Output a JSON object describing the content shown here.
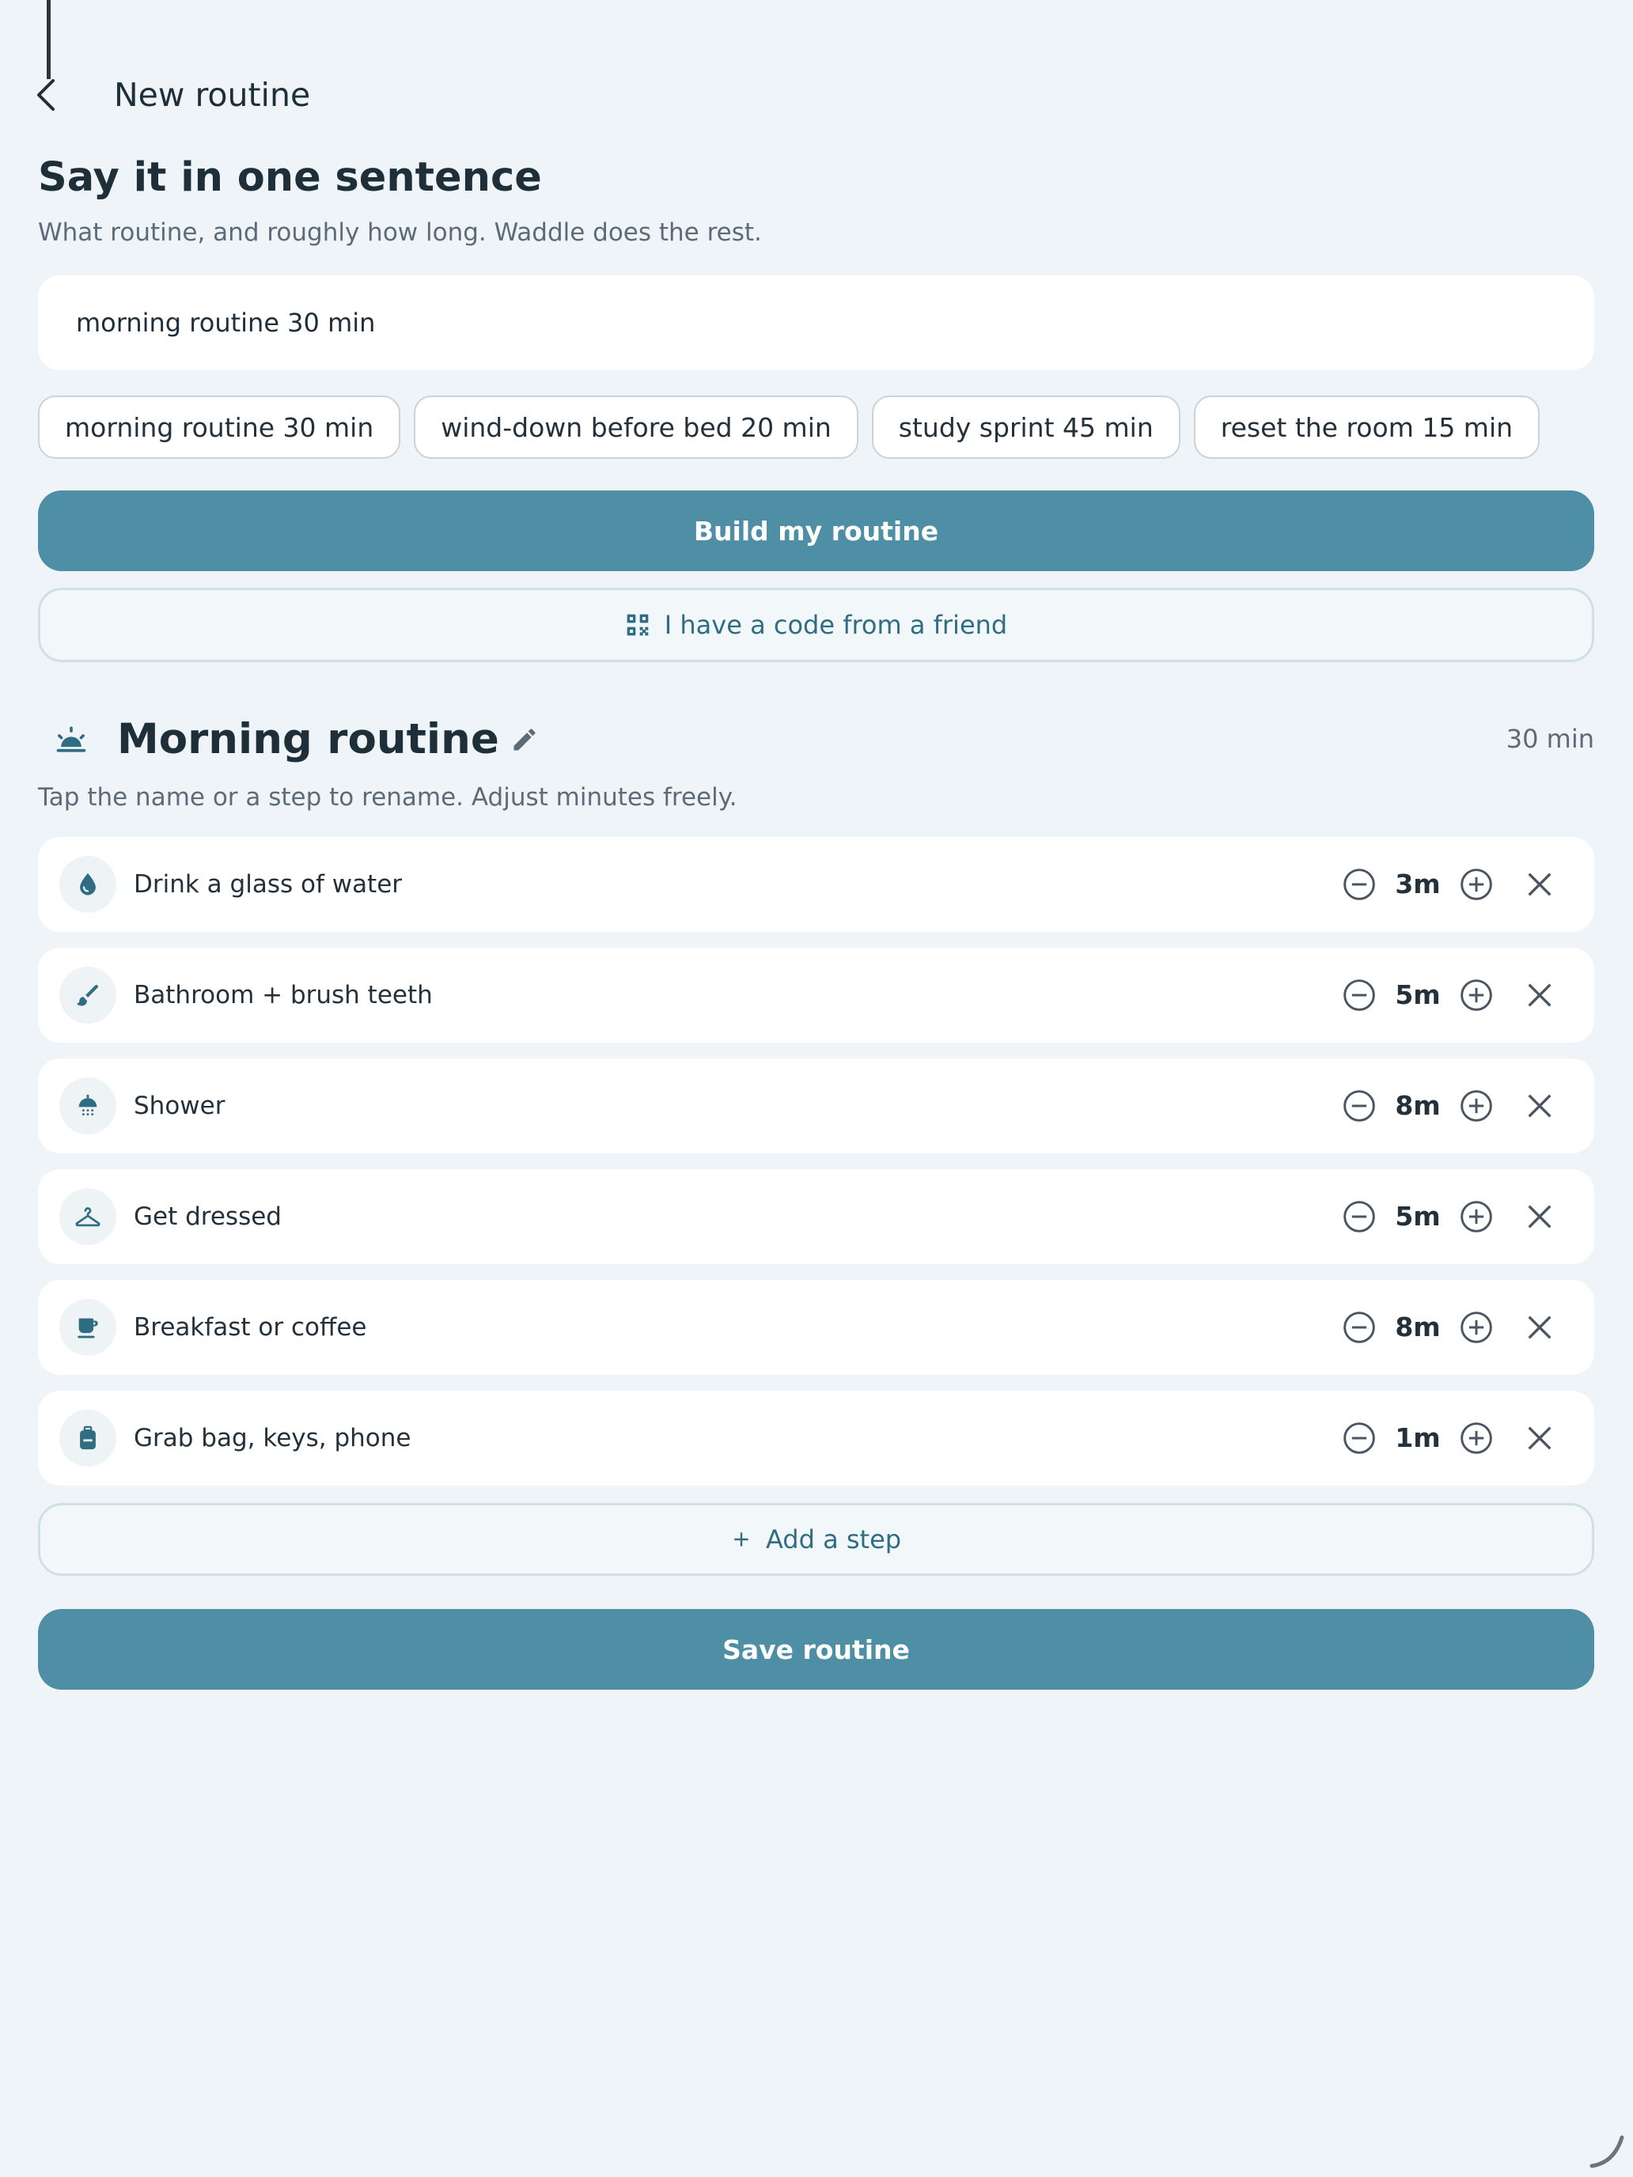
{
  "header": {
    "title": "New routine"
  },
  "prompt": {
    "heading": "Say it in one sentence",
    "subtitle": "What routine, and roughly how long. Waddle does the rest.",
    "input_value": "morning routine 30 min"
  },
  "suggestions": [
    "morning routine 30 min",
    "wind-down before bed 20 min",
    "study sprint 45 min",
    "reset the room 15 min"
  ],
  "actions": {
    "build_label": "Build my routine",
    "code_label": "I have a code from a friend"
  },
  "routine": {
    "name": "Morning routine",
    "total": "30 min",
    "hint": "Tap the name or a step to rename. Adjust minutes freely.",
    "steps": [
      {
        "label": "Drink a glass of water",
        "minutes": "3m",
        "icon": "water-drop-icon"
      },
      {
        "label": "Bathroom + brush teeth",
        "minutes": "5m",
        "icon": "brush-icon"
      },
      {
        "label": "Shower",
        "minutes": "8m",
        "icon": "shower-icon"
      },
      {
        "label": "Get dressed",
        "minutes": "5m",
        "icon": "hanger-icon"
      },
      {
        "label": "Breakfast or coffee",
        "minutes": "8m",
        "icon": "coffee-cup-icon"
      },
      {
        "label": "Grab bag, keys, phone",
        "minutes": "1m",
        "icon": "backpack-icon"
      }
    ],
    "add_step_label": "Add a step",
    "save_label": "Save routine"
  },
  "colors": {
    "background": "#eff4f8",
    "accent": "#4f8fa5",
    "icon": "#2f6d82",
    "text": "#1f2f3a"
  }
}
